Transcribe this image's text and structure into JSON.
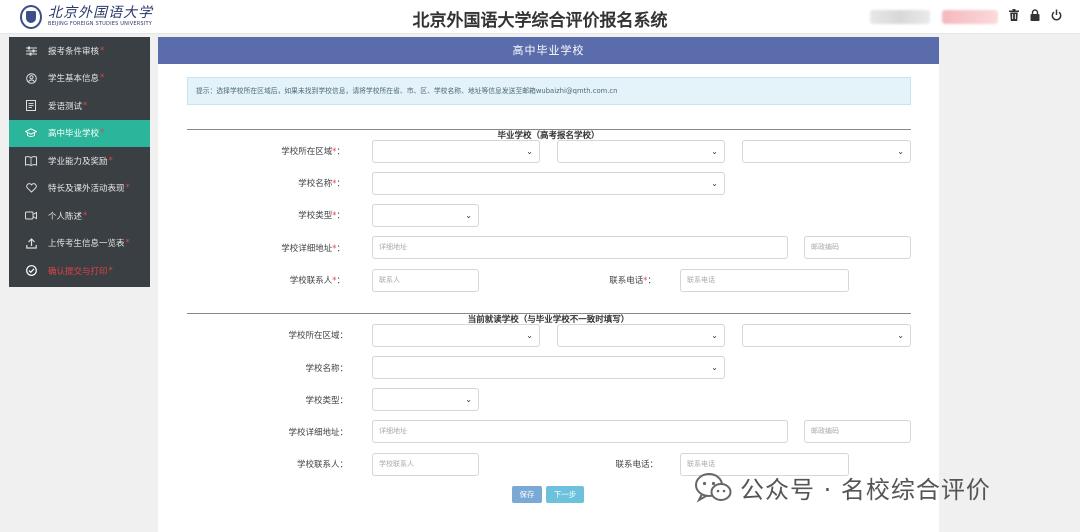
{
  "header": {
    "logo_cn": "北京外国语大学",
    "logo_en": "BEIJING FOREIGN STUDIES UNIVERSITY",
    "system_title": "北京外国语大学综合评价报名系统",
    "icons": [
      "trash-icon",
      "lock-icon",
      "power-icon"
    ]
  },
  "sidebar": {
    "items": [
      {
        "label": "报考条件审核",
        "icon": "sliders-icon",
        "required": "*"
      },
      {
        "label": "学生基本信息",
        "icon": "user-circle-icon",
        "required": "*"
      },
      {
        "label": "爱语测试",
        "icon": "document-icon",
        "required": "*"
      },
      {
        "label": "高中毕业学校",
        "icon": "graduation-cap-icon",
        "required": "*"
      },
      {
        "label": "学业能力及奖励",
        "icon": "book-icon",
        "required": "*"
      },
      {
        "label": "特长及课外活动表现",
        "icon": "heart-icon",
        "required": "*"
      },
      {
        "label": "个人陈述",
        "icon": "video-icon",
        "required": "*"
      },
      {
        "label": "上传考生信息一览表",
        "icon": "upload-icon",
        "required": "*"
      },
      {
        "label": "确认提交与打印",
        "icon": "check-circle-icon",
        "required": "*"
      }
    ]
  },
  "panel": {
    "title": "高中毕业学校",
    "hint": "提示：选择学校所在区域后，如果未找到学校信息，请将学校所在省、市、区、学校名称、地址等信息发送至邮箱wubaizhi@qmth.com.cn"
  },
  "section1": {
    "title": "毕业学校（高考报名学校）",
    "region_label": "学校所在区域",
    "name_label": "学校名称",
    "type_label": "学校类型",
    "address_label": "学校详细地址",
    "address_placeholder": "详细地址",
    "postcode_placeholder": "邮政编码",
    "contact_label": "学校联系人",
    "contact_placeholder": "联系人",
    "phone_label": "联系电话",
    "phone_placeholder": "联系电话",
    "required_mark": "*",
    "colon": "："
  },
  "section2": {
    "title": "当前就读学校（与毕业学校不一致时填写）",
    "region_label": "学校所在区域：",
    "name_label": "学校名称：",
    "type_label": "学校类型：",
    "address_label": "学校详细地址：",
    "address_placeholder": "详细地址",
    "postcode_placeholder": "邮政编码",
    "contact_label": "学校联系人：",
    "contact_placeholder": "学校联系人",
    "phone_label": "联系电话：",
    "phone_placeholder": "联系电话"
  },
  "buttons": {
    "save": "保存",
    "next": "下一步"
  },
  "watermark": {
    "text": "公众号 · 名校综合评价"
  },
  "colors": {
    "panel_header": "#5a6cab",
    "sidebar_bg": "#3a3f44",
    "sidebar_active": "#2bb59a",
    "required": "#e04646"
  }
}
